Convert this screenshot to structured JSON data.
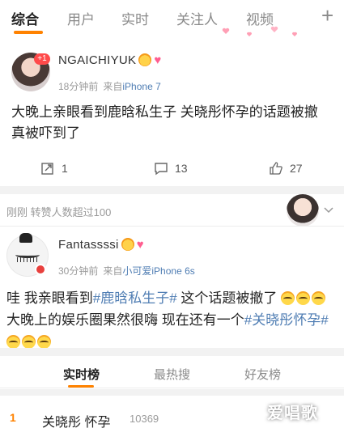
{
  "tabs": [
    {
      "label": "综合",
      "active": true
    },
    {
      "label": "用户",
      "active": false
    },
    {
      "label": "实时",
      "active": false
    },
    {
      "label": "关注人",
      "active": false
    },
    {
      "label": "视频",
      "active": false
    }
  ],
  "tab_more_icon": "plus-icon",
  "accent_color": "#ff8200",
  "link_color": "#4f7db3",
  "post1": {
    "username": "NGAICHIYUK",
    "badge": "+1",
    "time": "18分钟前",
    "source_prefix": "来自",
    "source": "iPhone 7",
    "text": "大晚上亲眼看到鹿晗私生子 关晓彤怀孕的话题被撤  真被吓到了",
    "reposts": "1",
    "comments": "13",
    "likes": "27"
  },
  "retweet_notice": "刚刚 转赞人数超过100",
  "post2": {
    "username": "Fantassssi",
    "time": "30分钟前",
    "source_prefix": "来自",
    "source": "小可爱iPhone 6s",
    "text_part1": "哇 我亲眼看到",
    "hashtag1": "#鹿晗私生子#",
    "text_part2": " 这个话题被撤了 ",
    "text_part3": "大晚上的娱乐圈果然很嗨 现在还有一个",
    "hashtag2": "#关晓彤怀孕#"
  },
  "sub_tabs": [
    {
      "label": "实时榜",
      "active": true
    },
    {
      "label": "最热搜",
      "active": false
    },
    {
      "label": "好友榜",
      "active": false
    }
  ],
  "hot_item": {
    "rank": "1",
    "title": "关晓彤 怀孕",
    "count": "10369"
  },
  "watermark": "爱唱歌"
}
